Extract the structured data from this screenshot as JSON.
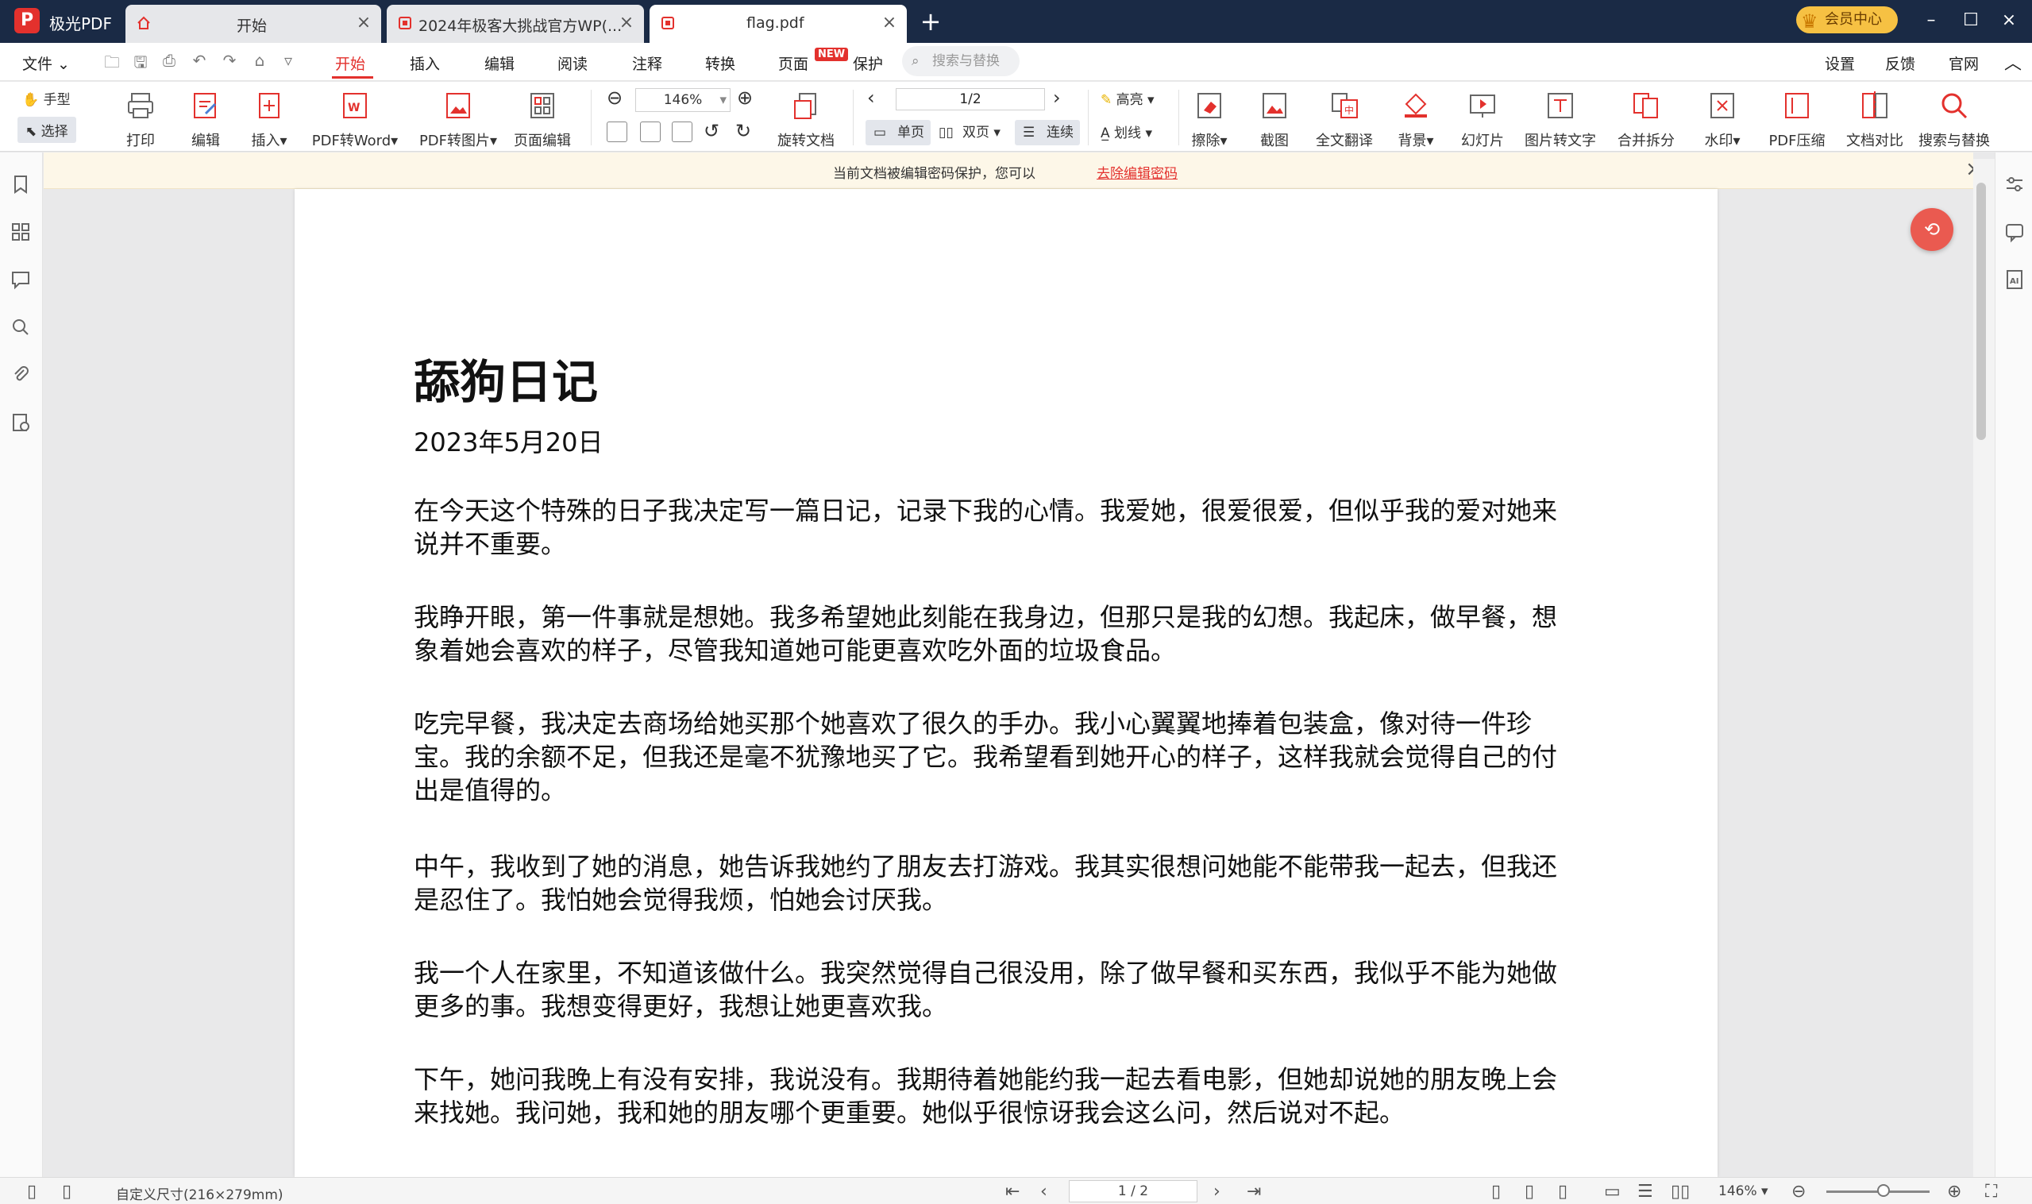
{
  "app": {
    "name": "极光PDF",
    "logo_letter": "P"
  },
  "tabs": [
    {
      "label": "开始",
      "icon": "home-icon"
    },
    {
      "label": "2024年极客大挑战官方WP(...",
      "icon": "pdf-icon"
    },
    {
      "label": "flag.pdf",
      "icon": "pdf-icon"
    }
  ],
  "titlebar": {
    "vip_label": "会员中心"
  },
  "menubar": {
    "file": "文件",
    "items": [
      "开始",
      "插入",
      "编辑",
      "阅读",
      "注释",
      "转换",
      "页面",
      "保护"
    ],
    "new_badge": "NEW",
    "search_placeholder": "搜索与替换",
    "right_items": [
      "设置",
      "反馈",
      "官网"
    ]
  },
  "ribbon": {
    "hand": "手型",
    "select": "选择",
    "print": "打印",
    "edit": "编辑",
    "insert": "插入",
    "pdf_to_word": "PDF转Word",
    "pdf_to_image": "PDF转图片",
    "page_edit": "页面编辑",
    "zoom": "146%",
    "rotate_doc": "旋转文档",
    "page_indicator": "1/2",
    "single_page": "单页",
    "double_page": "双页",
    "continuous": "连续",
    "highlight": "高亮",
    "underline": "划线",
    "erase": "擦除",
    "screenshot": "截图",
    "full_translate": "全文翻译",
    "background": "背景",
    "slideshow": "幻灯片",
    "image_to_text": "图片转文字",
    "merge_split": "合并拆分",
    "watermark": "水印",
    "pdf_compress": "PDF压缩",
    "doc_compare": "文档对比",
    "search_replace": "搜索与替换"
  },
  "notification": {
    "text": "当前文档被编辑密码保护，您可以",
    "link": "去除编辑密码"
  },
  "document": {
    "title": "舔狗日记",
    "date": "2023年5月20日",
    "paragraphs": [
      "在今天这个特殊的日子我决定写一篇日记，记录下我的心情。我爱她，很爱很爱，但似乎我的爱对她来说并不重要。",
      "我睁开眼，第一件事就是想她。我多希望她此刻能在我身边，但那只是我的幻想。我起床，做早餐，想象着她会喜欢的样子，尽管我知道她可能更喜欢吃外面的垃圾食品。",
      "吃完早餐，我决定去商场给她买那个她喜欢了很久的手办。我小心翼翼地捧着包装盒，像对待一件珍宝。我的余额不足，但我还是毫不犹豫地买了它。我希望看到她开心的样子，这样我就会觉得自己的付出是值得的。",
      "中午，我收到了她的消息，她告诉我她约了朋友去打游戏。我其实很想问她能不能带我一起去，但我还是忍住了。我怕她会觉得我烦，怕她会讨厌我。",
      "我一个人在家里，不知道该做什么。我突然觉得自己很没用，除了做早餐和买东西，我似乎不能为她做更多的事。我想变得更好，我想让她更喜欢我。",
      "下午，她问我晚上有没有安排，我说没有。我期待着她能约我一起去看电影，但她却说她的朋友晚上会来找她。我问她，我和她的朋友哪个更重要。她似乎很惊讶我会这么问，然后说对不起。"
    ]
  },
  "statusbar": {
    "page_size": "自定义尺寸(216×279mm)",
    "page": "1 / 2",
    "zoom": "146%"
  },
  "colors": {
    "accent": "#e3312d",
    "titlebar": "#1a2a45"
  }
}
